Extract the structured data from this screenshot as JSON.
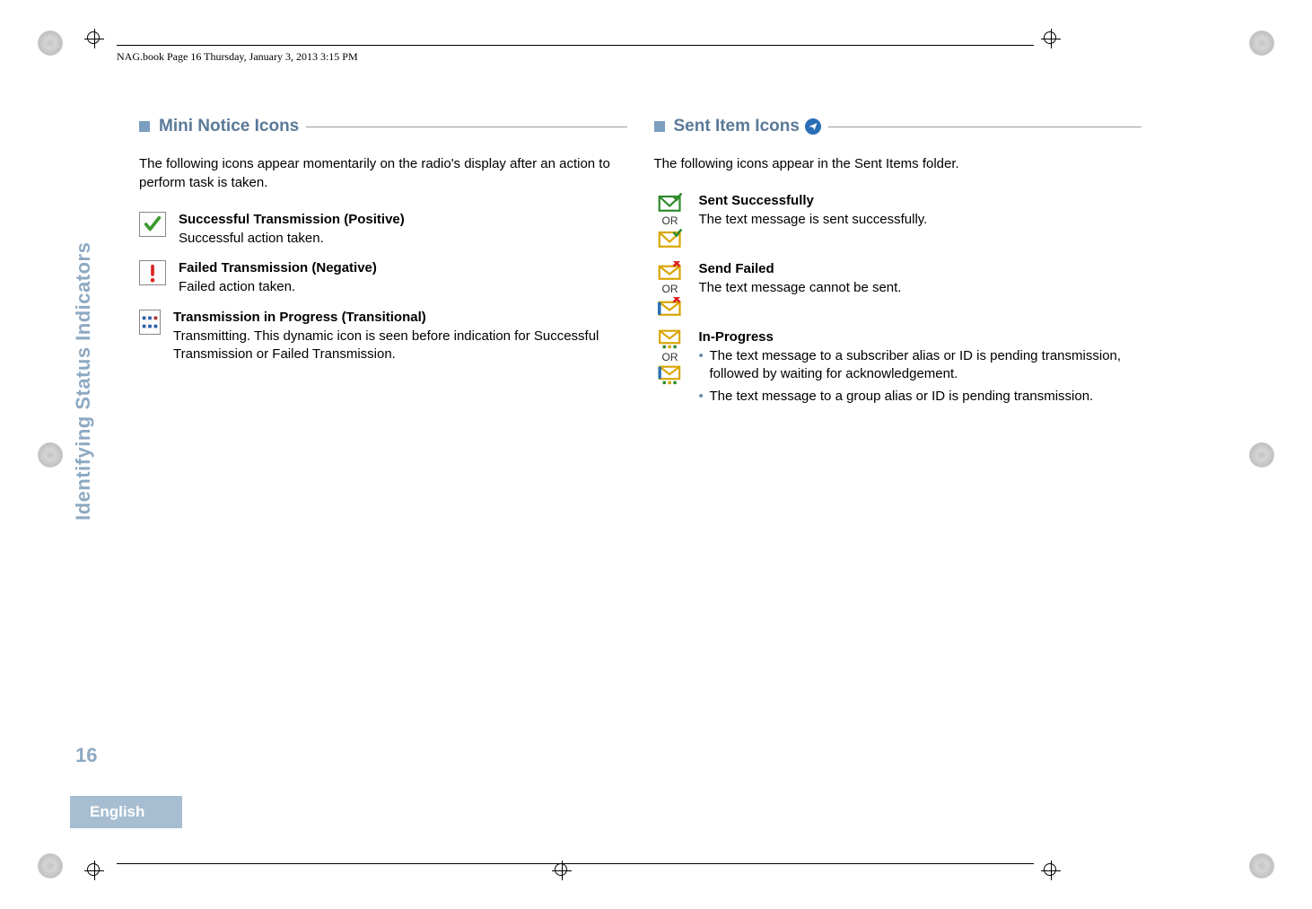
{
  "header": "NAG.book  Page 16  Thursday, January 3, 2013  3:15 PM",
  "side_label": "Identifying Status Indicators",
  "page_number": "16",
  "language_tab": "English",
  "left": {
    "title": "Mini Notice Icons",
    "intro": "The following icons appear momentarily on the radio's display after an action to perform task is taken.",
    "items": [
      {
        "title": "Successful Transmission (Positive)",
        "desc": "Successful action taken."
      },
      {
        "title": "Failed Transmission (Negative)",
        "desc": "Failed action taken."
      },
      {
        "title": "Transmission in Progress (Transitional)",
        "desc": "Transmitting. This dynamic icon is seen before indication for Successful Transmission or Failed Transmission."
      }
    ]
  },
  "right": {
    "title": "Sent Item Icons",
    "intro": "The following icons appear in the Sent Items folder.",
    "or_label": "OR",
    "items": [
      {
        "title": "Sent Successfully",
        "desc": "The text message is sent successfully."
      },
      {
        "title": "Send Failed",
        "desc": "The text message cannot be sent."
      },
      {
        "title": "In-Progress",
        "bullets": [
          "The text message to a subscriber alias or ID is pending transmission, followed by waiting for acknowledgement.",
          "The text message to a group alias or ID is pending transmission."
        ]
      }
    ]
  }
}
